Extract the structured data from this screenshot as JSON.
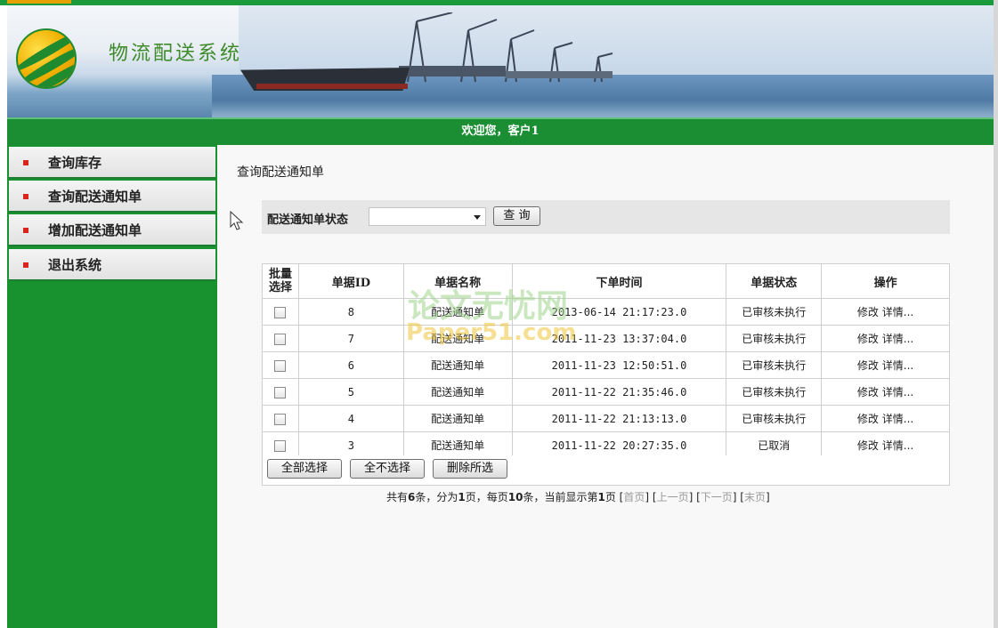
{
  "banner": {
    "system_title": "物流配送系统"
  },
  "welcome": {
    "text": "欢迎您，客户1"
  },
  "sidebar": {
    "items": [
      {
        "label": "查询库存"
      },
      {
        "label": "查询配送通知单"
      },
      {
        "label": "增加配送通知单"
      },
      {
        "label": "退出系统"
      }
    ]
  },
  "main": {
    "page_title": "查询配送通知单",
    "search": {
      "label": "配送通知单状态",
      "selected_value": "",
      "query_button": "查 询"
    },
    "table": {
      "headers": [
        "批量选择",
        "单据ID",
        "单据名称",
        "下单时间",
        "单据状态",
        "操作"
      ],
      "rows": [
        {
          "id": "8",
          "name": "配送通知单",
          "time": "2013-06-14 21:17:23.0",
          "status": "已审核未执行",
          "edit": "修改",
          "detail": "详情..."
        },
        {
          "id": "7",
          "name": "配送通知单",
          "time": "2011-11-23 13:37:04.0",
          "status": "已审核未执行",
          "edit": "修改",
          "detail": "详情..."
        },
        {
          "id": "6",
          "name": "配送通知单",
          "time": "2011-11-23 12:50:51.0",
          "status": "已审核未执行",
          "edit": "修改",
          "detail": "详情..."
        },
        {
          "id": "5",
          "name": "配送通知单",
          "time": "2011-11-22 21:35:46.0",
          "status": "已审核未执行",
          "edit": "修改",
          "detail": "详情..."
        },
        {
          "id": "4",
          "name": "配送通知单",
          "time": "2011-11-22 21:13:13.0",
          "status": "已审核未执行",
          "edit": "修改",
          "detail": "详情..."
        },
        {
          "id": "3",
          "name": "配送通知单",
          "time": "2011-11-22 20:27:35.0",
          "status": "已取消",
          "edit": "修改",
          "detail": "详情..."
        }
      ]
    },
    "buttons": {
      "select_all": "全部选择",
      "select_none": "全不选择",
      "delete_selected": "删除所选"
    },
    "pager": {
      "t1": "共有",
      "total": "6",
      "t2": "条，分为",
      "pages": "1",
      "t3": "页，每页",
      "per_page": "10",
      "t4": "条，当前显示第",
      "current": "1",
      "t5": "页",
      "first": "首页",
      "prev": "上一页",
      "next": "下一页",
      "last": "末页"
    }
  },
  "watermark": {
    "line1": "论文无忧网",
    "line2": "Paper51.com"
  },
  "colors": {
    "brand_green": "#18912f",
    "menu_bullet": "#d8241d",
    "accent": "#e8a000"
  }
}
